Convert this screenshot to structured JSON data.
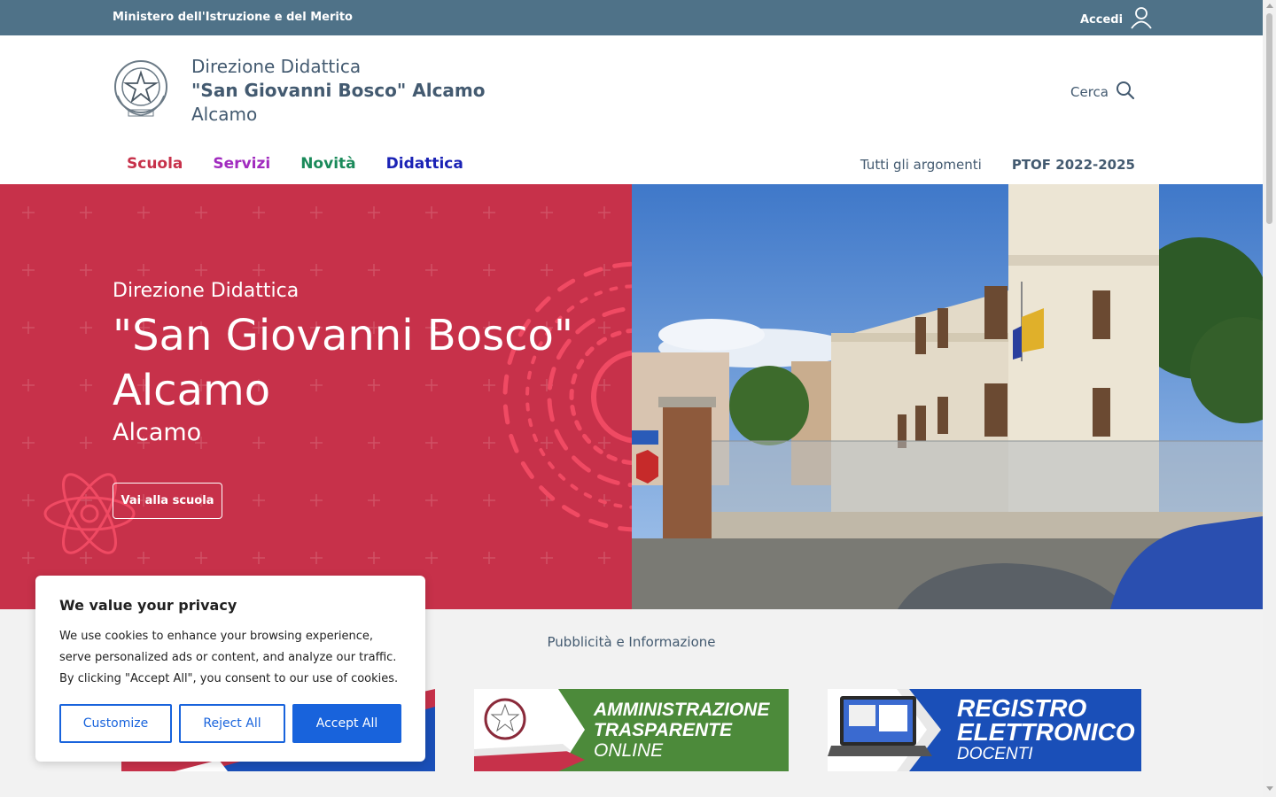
{
  "topbar": {
    "ministry": "Ministero dell'Istruzione e del Merito",
    "login_label": "Accedi"
  },
  "header": {
    "name_line1": "Direzione Didattica",
    "name_line2": "\"San Giovanni Bosco\" Alcamo",
    "name_line3": "Alcamo",
    "search_label": "Cerca"
  },
  "nav": {
    "main": [
      {
        "label": "Scuola",
        "color": "#c7314a"
      },
      {
        "label": "Servizi",
        "color": "#a12bbf"
      },
      {
        "label": "Novità",
        "color": "#1a8a5a"
      },
      {
        "label": "Didattica",
        "color": "#1a22b5"
      }
    ],
    "side": [
      "Tutti gli argomenti",
      "PTOF 2022-2025"
    ]
  },
  "hero": {
    "pre": "Direzione Didattica",
    "big_line1": "\"San Giovanni Bosco\"",
    "big_line2": "Alcamo",
    "sub": "Alcamo",
    "button": "Vai alla scuola",
    "accent": "#c7314a"
  },
  "ads": {
    "title": "Pubblicità e Informazione",
    "banners": [
      {
        "line1": "AMMINISTRAZIONE",
        "line2": "TRASPARENTE",
        "line3": "ONLINE",
        "color": "#4c8a3a"
      },
      {
        "line1": "REGISTRO",
        "line2": "ELETTRONICO",
        "line3": "DOCENTI",
        "color": "#1a4fb8"
      }
    ]
  },
  "cookie": {
    "title": "We value your privacy",
    "body": "We use cookies to enhance your browsing experience, serve personalized ads or content, and analyze our traffic. By clicking \"Accept All\", you consent to our use of cookies.",
    "customize": "Customize",
    "reject": "Reject All",
    "accept": "Accept All",
    "accent": "#1863dc"
  }
}
